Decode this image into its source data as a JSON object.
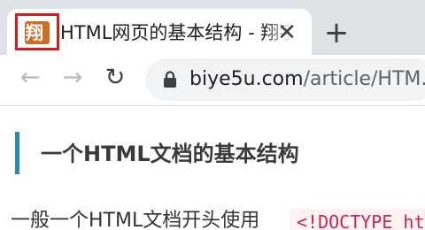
{
  "tab": {
    "title": "HTML网页的基本结构 - 翔宇亭",
    "close_glyph": "✕",
    "new_tab_glyph": "+",
    "favicon_icon": "site-favicon"
  },
  "toolbar": {
    "back_glyph": "←",
    "forward_glyph": "→",
    "reload_glyph": "↻",
    "url_host": "biye5u.com",
    "url_path": "/article/HTM..."
  },
  "article": {
    "heading": "一个HTML文档的基本结构",
    "paragraph": "一般一个HTML文档开头使用",
    "code": "<!DOCTYPE ht"
  },
  "colors": {
    "heading_accent": "#2b8bae",
    "favicon_highlight": "#d31d1d",
    "code_text": "#c7254e"
  }
}
